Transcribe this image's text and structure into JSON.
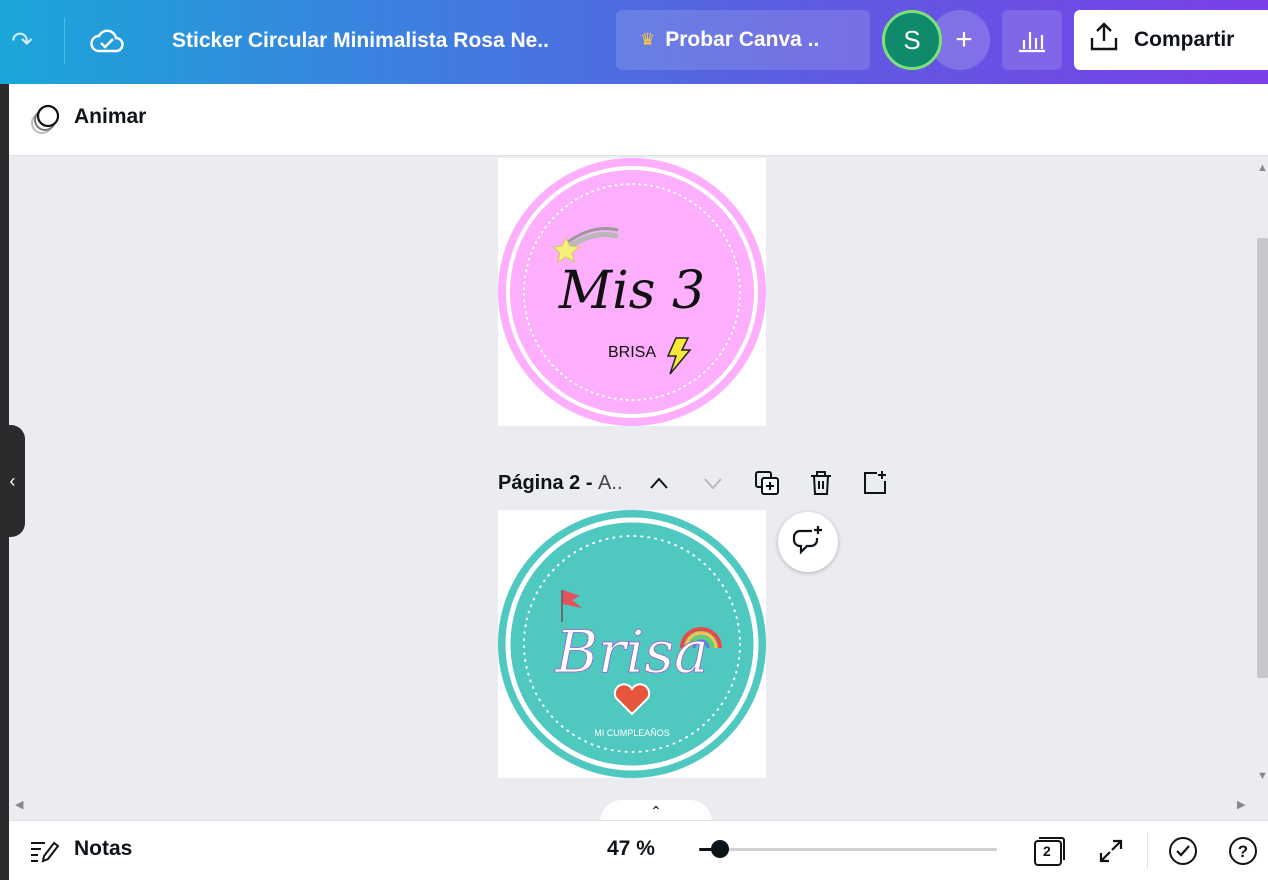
{
  "topbar": {
    "doc_title": "Sticker Circular Minimalista Rosa Ne..",
    "try_label": "Probar Canva ..",
    "avatar_initial": "S",
    "add_label": "+",
    "share_label": "Compartir"
  },
  "toolbar": {
    "animate_label": "Animar"
  },
  "pages": [
    {
      "label": "",
      "background": "#fdaefc",
      "text_main": "Mis 3",
      "text_sub": "BRISA"
    },
    {
      "label_main": "Página 2 -",
      "label_sub": "A..",
      "background": "#4fc9bf",
      "text_main": "Brisa",
      "text_sub": "MI CUMPLEAÑOS"
    }
  ],
  "bottombar": {
    "notes_label": "Notas",
    "zoom_label": "47 %",
    "zoom_fraction": 0.07,
    "page_count": "2"
  },
  "colors": {
    "topbar_start": "#1aa6d8",
    "topbar_end": "#7a3fe8",
    "avatar": "#0f8a6a",
    "crown": "#ffc83d"
  }
}
